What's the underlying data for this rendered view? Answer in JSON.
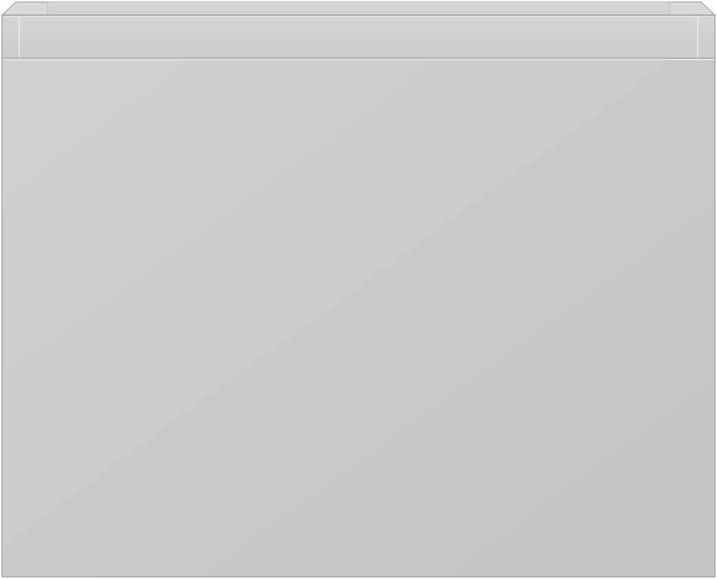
{
  "subject": {
    "colors": {
      "background": "#ffffff",
      "front_light": "#d1d1cf",
      "front_dark": "#c5c5c3",
      "rim": "#cdcdcb",
      "inner_back": "#d4d4d2",
      "inner_floor": "#cfcfcd",
      "edge_highlight": "#e9e9e7",
      "edge_line": "#8f8f8d"
    }
  }
}
